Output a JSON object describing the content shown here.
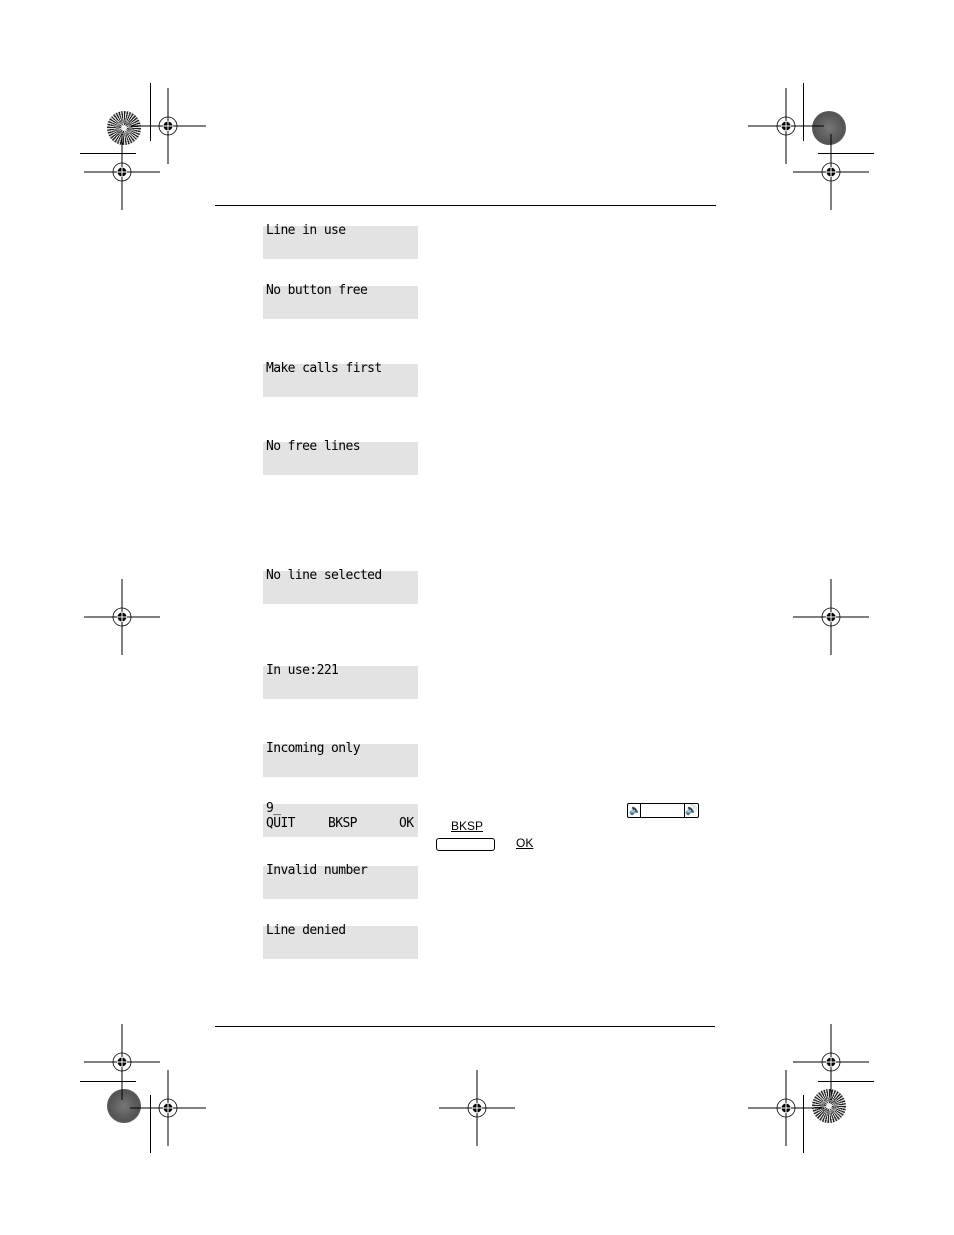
{
  "displays": [
    {
      "line1": "Line in use",
      "line2": ""
    },
    {
      "line1": "No button free",
      "line2": ""
    },
    {
      "line1": "Make calls first",
      "line2": ""
    },
    {
      "line1": "No free lines",
      "line2": ""
    },
    {
      "line1": "No line selected",
      "line2": ""
    },
    {
      "line1": "In use:221",
      "line2": ""
    },
    {
      "line1": "Incoming only",
      "line2": ""
    },
    {
      "line1": "9_",
      "softkeys": [
        "QUIT",
        "BKSP",
        "OK"
      ]
    },
    {
      "line1": "Invalid number",
      "line2": ""
    },
    {
      "line1": "Line denied",
      "line2": ""
    }
  ],
  "side_annotations": {
    "volume_bar_icon": "volume-bar",
    "bksp_label": "BKSP",
    "ok_label": "OK"
  }
}
